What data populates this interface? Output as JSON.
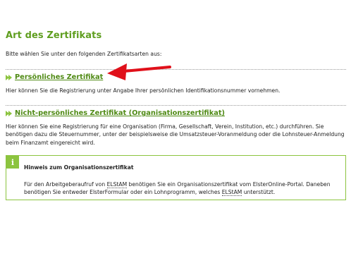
{
  "page": {
    "title": "Art des Zertifikats",
    "intro": "Bitte wählen Sie unter den folgenden Zertifikatsarten aus:"
  },
  "options": [
    {
      "label": "Persönliches Zertifikat",
      "description": "Hier können Sie die Registrierung unter Angabe Ihrer persönlichen Identifikationsnummer vornehmen."
    },
    {
      "label": "Nicht-persönliches Zertifikat (Organisationszertifikat)",
      "description": "Hier können Sie eine Registrierung für eine Organisation (Firma, Gesellschaft, Verein, Institution, etc.) durchführen. Sie benötigen dazu die Steuernummer, unter der beispielsweise die Umsatzsteuer-Voranmeldung oder die Lohnsteuer-Anmeldung beim Finanzamt eingereicht wird."
    }
  ],
  "note": {
    "icon_label": "i",
    "title": "Hinweis zum Organisationszertifikat",
    "body_part1": "Für den Arbeitgeberaufruf von ",
    "elstam_1": "ELStAM",
    "body_part2": " benötigen Sie ein Organisationszertifikat vom ElsterOnline-Portal. Daneben benötigen Sie entweder ElsterFormular oder ein Lohnprogramm, welches ",
    "elstam_2": "ELStAM",
    "body_part3": " unterstützt."
  },
  "colors": {
    "accent_green": "#5f9e1f",
    "link_green": "#4f8a14",
    "note_border": "#8cc43f",
    "annotation_red": "#e0101a"
  },
  "icons": {
    "option_bullet": "double-chevron-right-icon",
    "note": "info-icon",
    "annotation": "red-pointer-arrow"
  }
}
